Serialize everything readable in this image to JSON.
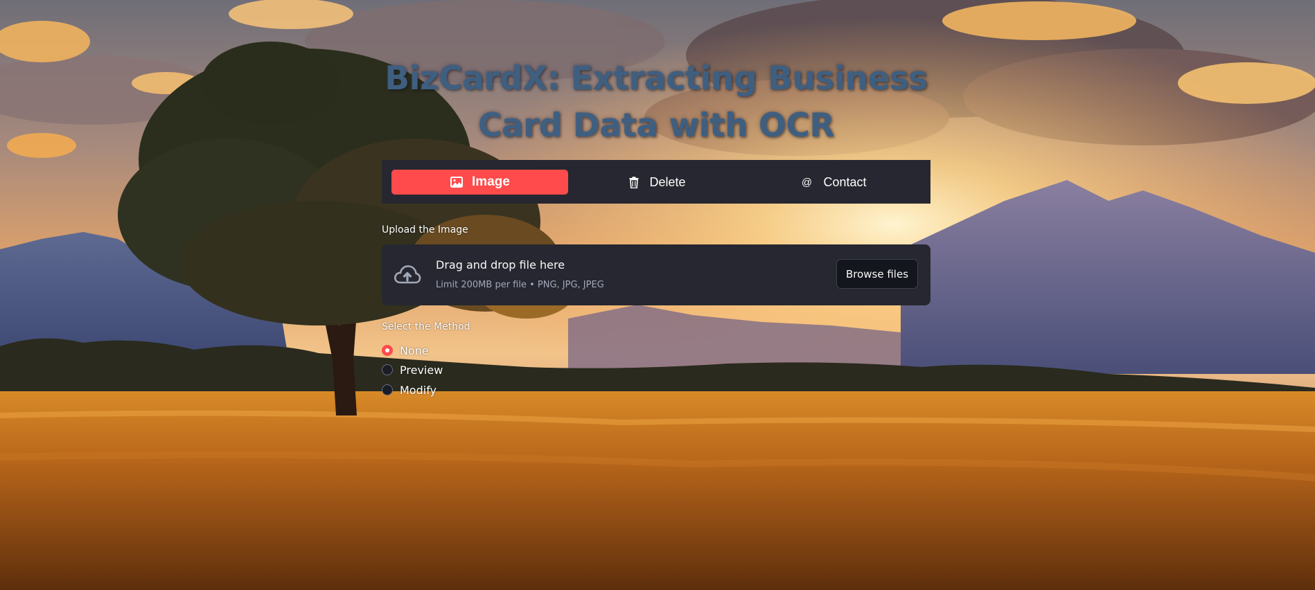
{
  "title": {
    "line1": "BizCardX: Extracting Business",
    "line2": "Card Data with OCR"
  },
  "nav": {
    "items": [
      {
        "label": "Image",
        "icon": "image-icon",
        "active": true
      },
      {
        "label": "Delete",
        "icon": "trash-icon",
        "active": false
      },
      {
        "label": "Contact",
        "icon": "at-icon",
        "active": false
      }
    ]
  },
  "upload": {
    "label": "Upload the Image",
    "drop_text": "Drag and drop file here",
    "limit_text": "Limit 200MB per file • PNG, JPG, JPEG",
    "browse_label": "Browse files",
    "icon": "cloud-upload-icon"
  },
  "method": {
    "label": "Select the Method",
    "options": [
      {
        "label": "None",
        "selected": true
      },
      {
        "label": "Preview",
        "selected": false
      },
      {
        "label": "Modify",
        "selected": false
      }
    ]
  },
  "colors": {
    "accent": "#ff4b4b",
    "panel": "#262730",
    "title": "#3f5f80"
  }
}
